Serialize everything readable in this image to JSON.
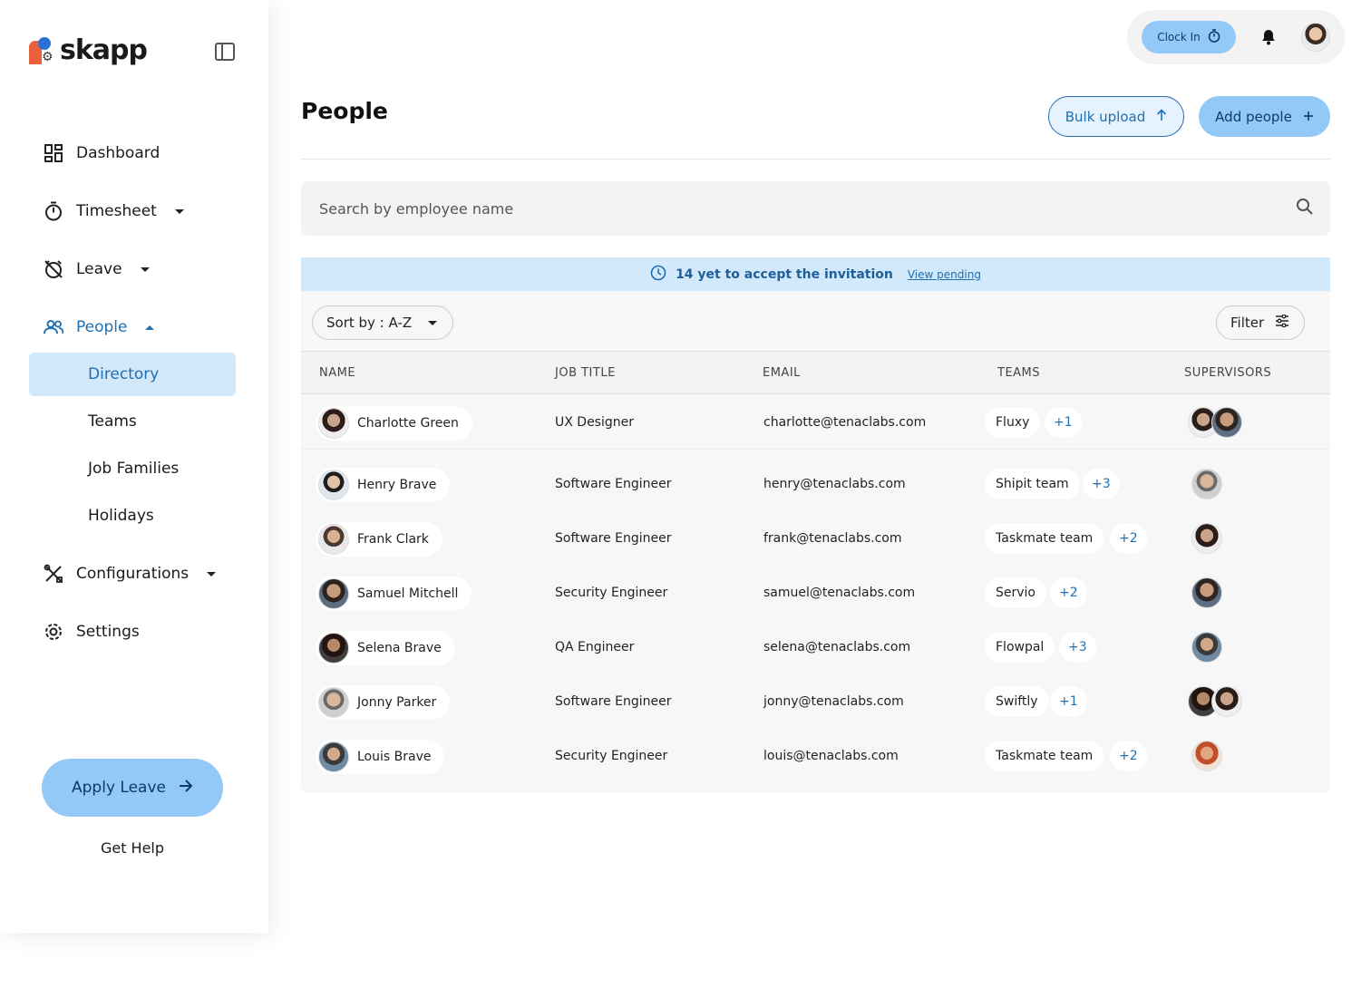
{
  "app": {
    "logo_text": "skapp"
  },
  "sidebar": {
    "items": [
      {
        "label": "Dashboard",
        "icon": "dashboard-icon"
      },
      {
        "label": "Timesheet",
        "icon": "timer-icon"
      },
      {
        "label": "Leave",
        "icon": "alarm-off-icon"
      },
      {
        "label": "People",
        "icon": "people-icon"
      },
      {
        "label": "Configurations",
        "icon": "tools-icon"
      },
      {
        "label": "Settings",
        "icon": "gear-icon"
      }
    ],
    "people_sub": [
      "Directory",
      "Teams",
      "Job Families",
      "Holidays"
    ],
    "apply_leave": "Apply Leave",
    "get_help": "Get Help"
  },
  "topbar": {
    "clock_in": "Clock In"
  },
  "page": {
    "title": "People",
    "bulk_upload": "Bulk upload",
    "add_people": "Add people"
  },
  "search": {
    "placeholder": "Search by employee name"
  },
  "banner": {
    "text": "14 yet to accept the invitation",
    "link": "View pending"
  },
  "toolbar": {
    "sort": "Sort by : A-Z",
    "filter": "Filter"
  },
  "table": {
    "columns": [
      "NAME",
      "JOB TITLE",
      "EMAIL",
      "TEAMS",
      "SUPERVISORS"
    ],
    "rows": [
      {
        "name": "Charlotte Green",
        "title": "UX Designer",
        "email": "charlotte@tenaclabs.com",
        "team": "Fluxy",
        "more": "+1"
      },
      {
        "name": "Henry Brave",
        "title": "Software Engineer",
        "email": "henry@tenaclabs.com",
        "team": "Shipit team",
        "more": "+3"
      },
      {
        "name": "Frank Clark",
        "title": "Software Engineer",
        "email": "frank@tenaclabs.com",
        "team": "Taskmate team",
        "more": "+2"
      },
      {
        "name": "Samuel Mitchell",
        "title": "Security Engineer",
        "email": "samuel@tenaclabs.com",
        "team": "Servio",
        "more": "+2"
      },
      {
        "name": "Selena Brave",
        "title": "QA Engineer",
        "email": "selena@tenaclabs.com",
        "team": "Flowpal",
        "more": "+3"
      },
      {
        "name": "Jonny Parker",
        "title": "Software Engineer",
        "email": "jonny@tenaclabs.com",
        "team": "Swiftly",
        "more": "+1"
      },
      {
        "name": "Louis Brave",
        "title": "Security Engineer",
        "email": "louis@tenaclabs.com",
        "team": "Taskmate team",
        "more": "+2"
      }
    ]
  },
  "colors": {
    "accent": "#93c9f7",
    "accent_text": "#1f6fb0",
    "banner_bg": "#d2e8fb"
  }
}
